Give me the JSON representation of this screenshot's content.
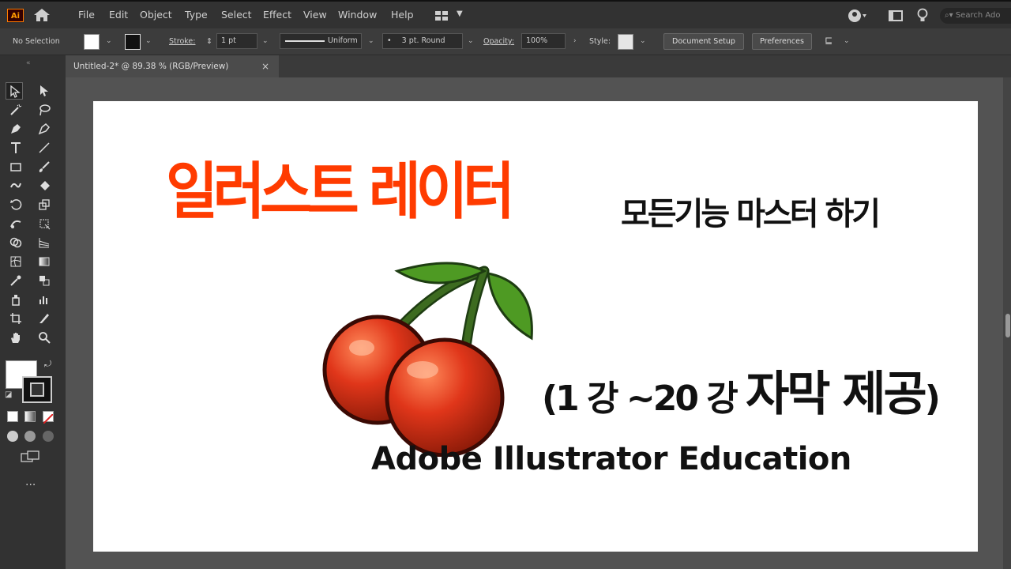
{
  "app": {
    "logo": "Ai"
  },
  "menu": [
    "File",
    "Edit",
    "Object",
    "Type",
    "Select",
    "Effect",
    "View",
    "Window",
    "Help"
  ],
  "search": {
    "placeholder": "Search Ado"
  },
  "control_bar": {
    "selection": "No Selection",
    "stroke_label": "Stroke:",
    "stroke_weight": "1 pt",
    "profile": "Uniform",
    "brush": "3 pt. Round",
    "opacity_label": "Opacity:",
    "opacity_value": "100%",
    "style_label": "Style:",
    "doc_setup": "Document Setup",
    "preferences": "Preferences"
  },
  "document_tab": {
    "title": "Untitled-2* @ 89.38 % (RGB/Preview)",
    "close": "×"
  },
  "toolbar": {
    "more": "..."
  },
  "artboard": {
    "title_main": "일러스트 레이터",
    "title_sub": "모든기능 마스터 하기",
    "lecture_prefix": "(1 강 ~20 강 ",
    "lecture_bold": "자막 제공",
    "lecture_suffix": ")",
    "education": "Adobe Illustrator Education"
  },
  "colors": {
    "title_red": "#ff3b00",
    "ui_dark": "#323232",
    "canvas": "#535353",
    "cherry": "#d8321a",
    "leaf": "#4e9a23"
  }
}
